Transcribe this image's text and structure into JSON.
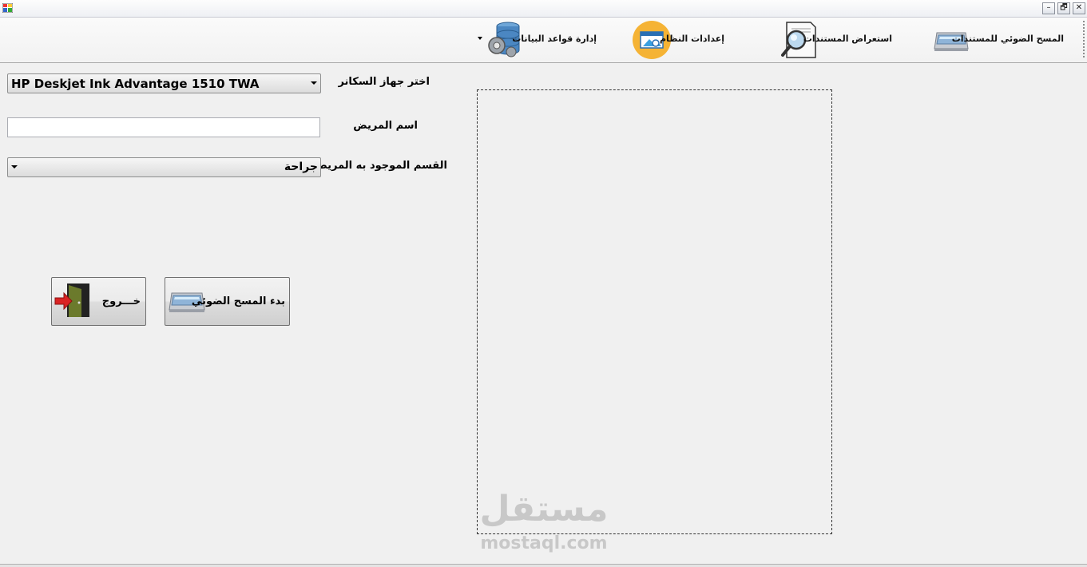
{
  "window": {
    "title": "",
    "minimize_glyph": "–",
    "restore_glyph": "🗗",
    "close_glyph": "✕"
  },
  "toolbar": {
    "items": [
      {
        "label": "المسح الضوئي للمستندات",
        "icon": "scanner-icon"
      },
      {
        "label": "استعراض المستندات",
        "icon": "document-search-icon"
      },
      {
        "label": "إعدادات النظام",
        "icon": "settings-window-icon"
      },
      {
        "label": "إدارة قواعد البيانات",
        "icon": "database-gear-icon",
        "has_dropdown": true
      }
    ]
  },
  "form": {
    "scanner_label": "اختر جهاز السكانر",
    "scanner_value": "HP Deskjet Ink Advantage 1510 TWA",
    "patient_name_label": "اسم المريض",
    "patient_name_value": "",
    "department_label": "القسم الموجود به المريض",
    "department_value": "جراحة"
  },
  "buttons": {
    "start_scan": "بدء المسح الضوئي",
    "exit": "خـــروج"
  },
  "watermark": {
    "arabic": "مستقل",
    "latin": "mostaql.com"
  }
}
